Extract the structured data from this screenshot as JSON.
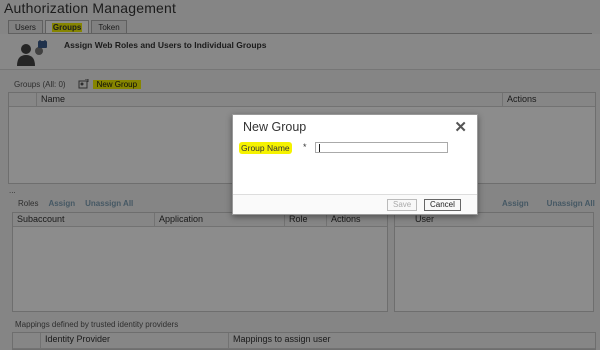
{
  "app": {
    "title": "Authorization Management"
  },
  "tabs": [
    {
      "label": "Users"
    },
    {
      "label": "Groups"
    },
    {
      "label": "Token"
    }
  ],
  "header": {
    "assign_title": "Assign Web Roles and Users to Individual Groups"
  },
  "groups": {
    "count_label": "Groups (All: 0)",
    "new_group_label": "New Group",
    "columns": [
      "Name",
      "Actions"
    ]
  },
  "dots": "...",
  "roles": {
    "label": "Roles",
    "assign": "Assign",
    "unassign_all": "Unassign All",
    "columns": [
      "Subaccount",
      "Application",
      "Role",
      "Actions"
    ]
  },
  "users": {
    "assign": "Assign",
    "unassign_all": "Unassign All",
    "columns": [
      "User"
    ]
  },
  "mappings": {
    "text": "Mappings defined by trusted identity providers",
    "columns": [
      "Identity Provider",
      "Mappings to assign user"
    ]
  },
  "dialog": {
    "title": "New Group",
    "field_label": "Group Name",
    "required": "*",
    "input_value": "",
    "save_label": "Save",
    "cancel_label": "Cancel"
  },
  "colors": {
    "highlight": "#f5f200",
    "overlay": "#000000"
  }
}
